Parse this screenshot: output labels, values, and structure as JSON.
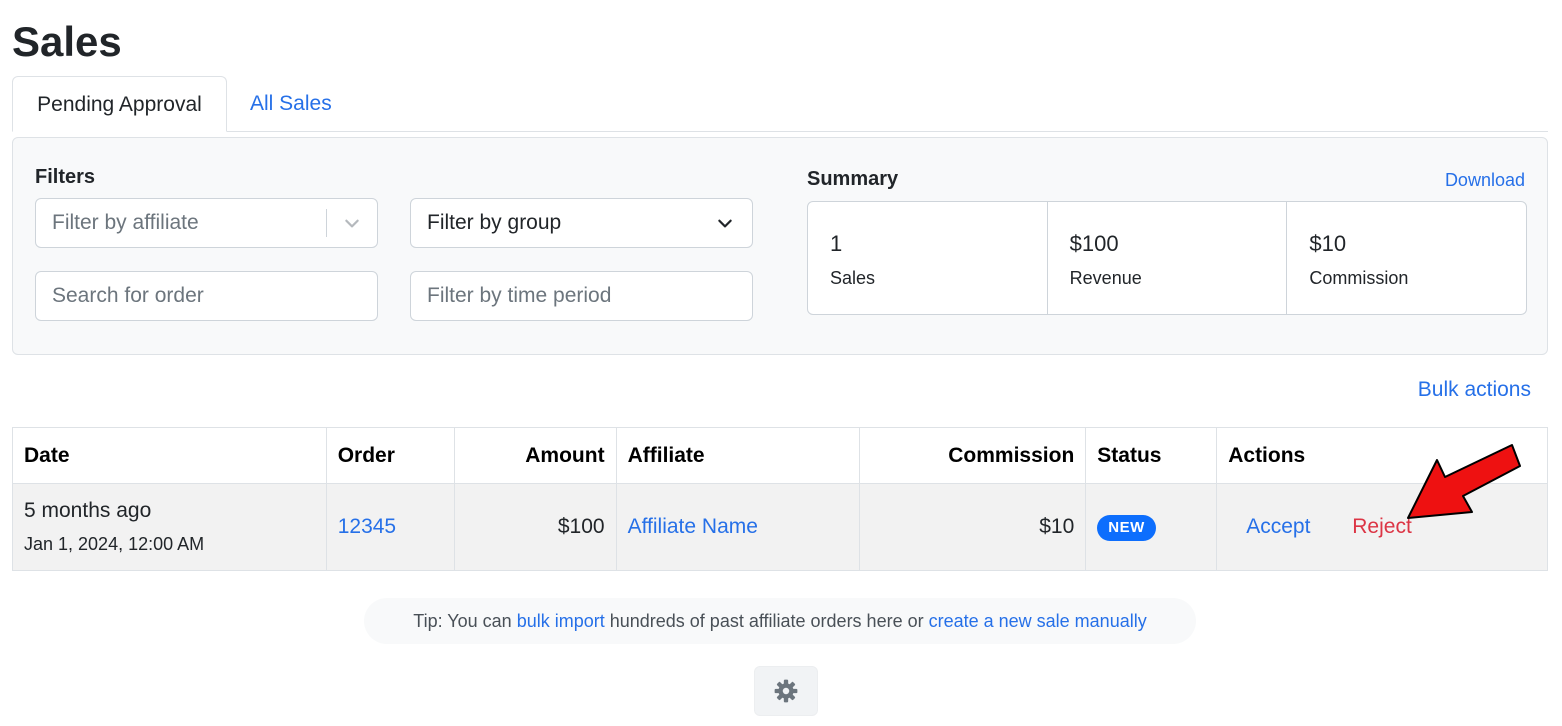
{
  "page": {
    "title": "Sales"
  },
  "tabs": [
    {
      "label": "Pending Approval",
      "active": true
    },
    {
      "label": "All Sales",
      "active": false
    }
  ],
  "filters": {
    "heading": "Filters",
    "affiliate": {
      "placeholder": "Filter by affiliate",
      "icon": "chevron-down-icon"
    },
    "group": {
      "value": "Filter by group",
      "icon": "chevron-down-icon"
    },
    "order_search": {
      "placeholder": "Search for order"
    },
    "time_period": {
      "placeholder": "Filter by time period"
    }
  },
  "summary": {
    "heading": "Summary",
    "download_label": "Download",
    "cards": [
      {
        "value": "1",
        "label": "Sales"
      },
      {
        "value": "$100",
        "label": "Revenue"
      },
      {
        "value": "$10",
        "label": "Commission"
      }
    ]
  },
  "bulk_actions_label": "Bulk actions",
  "table": {
    "columns": [
      "Date",
      "Order",
      "Amount",
      "Affiliate",
      "Commission",
      "Status",
      "Actions"
    ],
    "rows": [
      {
        "date_relative": "5 months ago",
        "date_full": "Jan 1, 2024, 12:00 AM",
        "order": "12345",
        "amount": "$100",
        "affiliate": "Affiliate Name",
        "commission": "$10",
        "status": "NEW",
        "accept_label": "Accept",
        "reject_label": "Reject"
      }
    ]
  },
  "tip": {
    "prefix": "Tip: You can ",
    "link1": "bulk import",
    "middle": " hundreds of past affiliate orders here or ",
    "link2": "create a new sale manually"
  },
  "settings": {
    "icon": "gear-icon"
  },
  "annotation": {
    "icon": "red-arrow-icon",
    "color": "#ee1111"
  },
  "colors": {
    "link": "#2670e8",
    "danger": "#dc3545",
    "badge": "#0d6efd"
  }
}
